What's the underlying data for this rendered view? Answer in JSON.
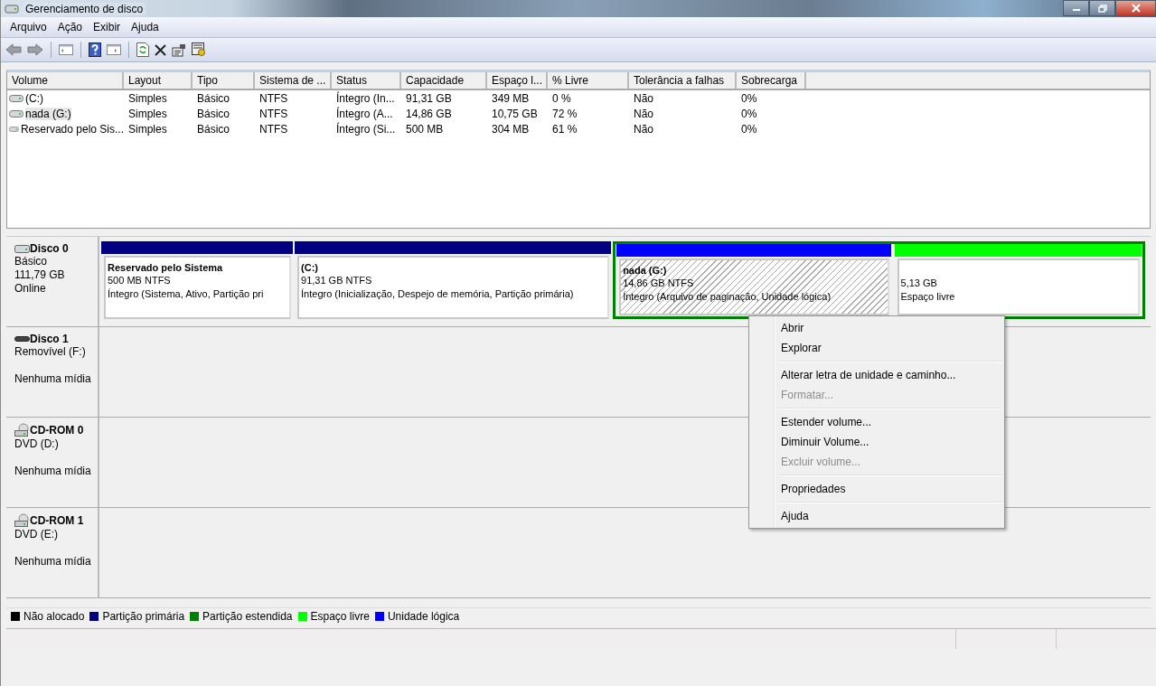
{
  "window": {
    "title": "Gerenciamento de disco"
  },
  "menu_bar": [
    "Arquivo",
    "Ação",
    "Exibir",
    "Ajuda"
  ],
  "table": {
    "columns": [
      "Volume",
      "Layout",
      "Tipo",
      "Sistema de ...",
      "Status",
      "Capacidade",
      "Espaço l...",
      "% Livre",
      "Tolerância a falhas",
      "Sobrecarga"
    ],
    "rows": [
      {
        "selected": false,
        "cells": [
          " (C:)",
          "Simples",
          "Básico",
          "NTFS",
          "Íntegro (In...",
          "91,31 GB",
          "349 MB",
          "0 %",
          "Não",
          "0%"
        ]
      },
      {
        "selected": true,
        "cells": [
          "nada (G:)",
          "Simples",
          "Básico",
          "NTFS",
          "Íntegro (A...",
          "14,86 GB",
          "10,75 GB",
          "72 %",
          "Não",
          "0%"
        ]
      },
      {
        "selected": false,
        "cells": [
          "Reservado pelo Sis...",
          "Simples",
          "Básico",
          "NTFS",
          "Íntegro (Si...",
          "500 MB",
          "304 MB",
          "61 %",
          "Não",
          "0%"
        ]
      }
    ]
  },
  "disks": [
    {
      "kind": "hdd",
      "name": "Disco 0",
      "lines": [
        "Básico",
        "111,79 GB",
        "Online"
      ],
      "partitions": [
        {
          "kind": "primary",
          "selected": false,
          "title": "Reservado pelo Sistema",
          "size": "500 MB NTFS",
          "status": "Íntegro (Sistema, Ativo, Partição pri"
        },
        {
          "kind": "primary",
          "selected": false,
          "title": " (C:)",
          "size": "91,31 GB NTFS",
          "status": "Íntegro (Inicialização, Despejo de memória, Partição primária)"
        },
        {
          "kind": "extended",
          "children": [
            {
              "kind": "logical",
              "selected": true,
              "title": "nada  (G:)",
              "size": "14,86 GB NTFS",
              "status": "Íntegro (Arquivo de paginação, Unidade lógica)"
            },
            {
              "kind": "free",
              "selected": false,
              "size": "5,13 GB",
              "status": "Espaço livre"
            }
          ]
        }
      ]
    },
    {
      "kind": "removable",
      "name": "Disco 1",
      "lines": [
        "Removível (F:)"
      ],
      "note": "Nenhuma mídia"
    },
    {
      "kind": "cdrom",
      "name": "CD-ROM 0",
      "lines": [
        "DVD (D:)"
      ],
      "note": "Nenhuma mídia"
    },
    {
      "kind": "cdrom",
      "name": "CD-ROM 1",
      "lines": [
        "DVD (E:)"
      ],
      "note": "Nenhuma mídia"
    }
  ],
  "legend": [
    {
      "label": "Não alocado",
      "color": "#000000"
    },
    {
      "label": "Partição primária",
      "color": "#000080"
    },
    {
      "label": "Partição estendida",
      "color": "#008000"
    },
    {
      "label": "Espaço livre",
      "color": "#00ff00"
    },
    {
      "label": "Unidade lógica",
      "color": "#0000ff"
    }
  ],
  "context_menu": {
    "groups": [
      [
        {
          "label": "Abrir",
          "disabled": false
        },
        {
          "label": "Explorar",
          "disabled": false
        }
      ],
      [
        {
          "label": "Alterar letra de unidade e caminho...",
          "disabled": false
        },
        {
          "label": "Formatar...",
          "disabled": true
        }
      ],
      [
        {
          "label": "Estender volume...",
          "disabled": false
        },
        {
          "label": "Diminuir Volume...",
          "disabled": false
        },
        {
          "label": "Excluir volume...",
          "disabled": true
        }
      ],
      [
        {
          "label": "Propriedades",
          "disabled": false
        }
      ],
      [
        {
          "label": "Ajuda",
          "disabled": false
        }
      ]
    ]
  }
}
